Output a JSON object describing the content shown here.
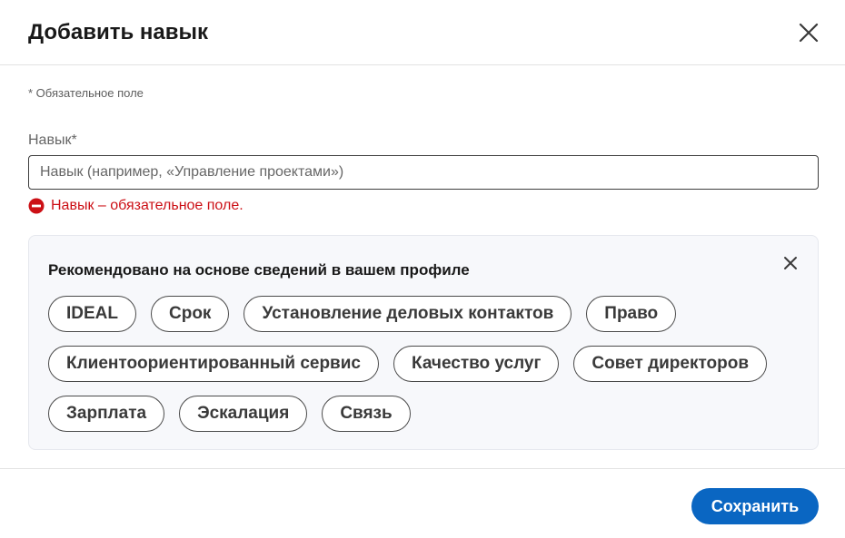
{
  "dialog": {
    "title": "Добавить навык"
  },
  "form": {
    "required_note": "* Обязательное поле",
    "skill_label": "Навык*",
    "skill_value": "",
    "skill_placeholder": "Навык (например, «Управление проектами»)",
    "error_message": "Навык – обязательное поле."
  },
  "recommendations": {
    "title": "Рекомендовано на основе сведений в вашем профиле",
    "rows": [
      [
        "IDEAL",
        "Срок",
        "Установление деловых контактов",
        "Право"
      ],
      [
        "Клиентоориентированный сервис",
        "Качество услуг",
        "Совет директоров"
      ],
      [
        "Зарплата",
        "Эскалация",
        "Связь"
      ]
    ]
  },
  "footer": {
    "save_label": "Сохранить"
  },
  "colors": {
    "primary": "#0a66c2",
    "error": "#cc1016",
    "panel_bg": "#f7f8fb"
  },
  "icons": {
    "close": "close-icon",
    "error": "error-stop-icon"
  }
}
